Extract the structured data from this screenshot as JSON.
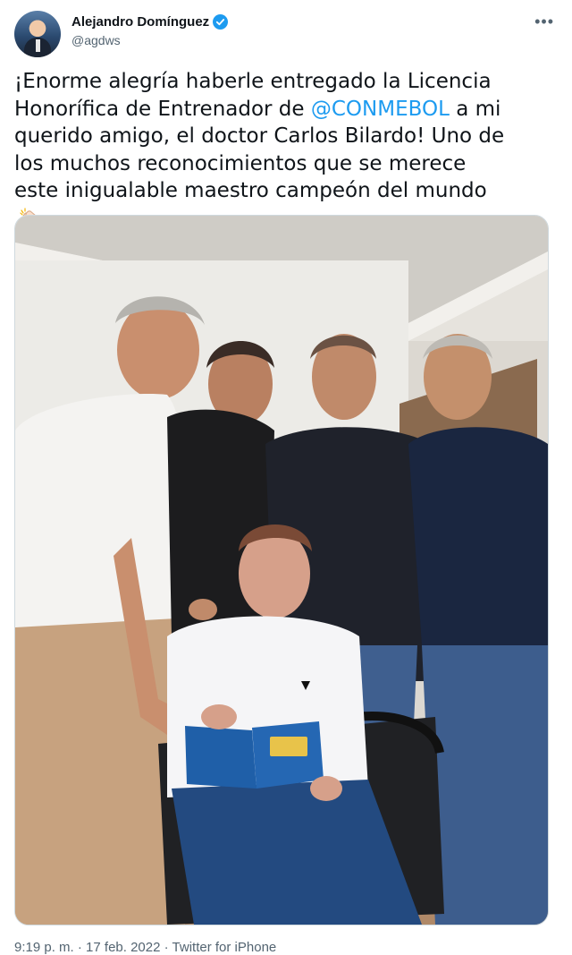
{
  "author": {
    "display_name": "Alejandro Domínguez",
    "handle": "@agdws",
    "verified": true
  },
  "menu_icon": "more-horizontal-icon",
  "tweet": {
    "text_before": "¡Enorme alegría haberle entregado la Licencia Honorífica de Entrenador de ",
    "mention": "@CONMEBOL",
    "text_after": " a mi querido amigo, el doctor Carlos Bilardo! Uno de los muchos reconocimientos que se merece este inigualable maestro campeón del mundo",
    "emoji": "clapping-hands-icon"
  },
  "media": {
    "type": "photo"
  },
  "meta": {
    "time": "9:19 p. m.",
    "separator": "·",
    "date": "17 feb. 2022",
    "source": "Twitter for iPhone"
  },
  "colors": {
    "link": "#1d9bf0",
    "secondary_text": "#536471",
    "primary_text": "#0f1419"
  }
}
